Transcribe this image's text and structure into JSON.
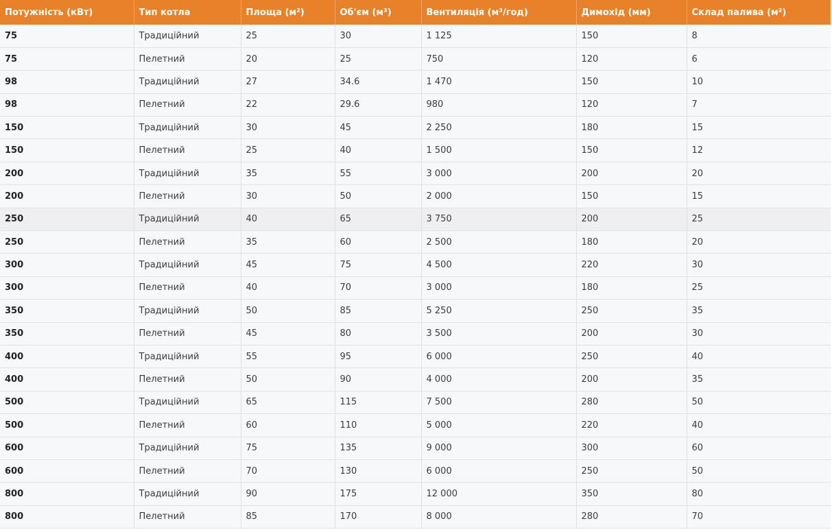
{
  "table": {
    "headers": [
      "Потужність (кВт)",
      "Тип котла",
      "Площа (м²)",
      "Об'єм (м³)",
      "Вентиляція (м³/год)",
      "Димохід (мм)",
      "Склад палива (м²)"
    ],
    "rows": [
      [
        "75",
        "Традиційний",
        "25",
        "30",
        "1 125",
        "150",
        "8"
      ],
      [
        "75",
        "Пелетний",
        "20",
        "25",
        "750",
        "120",
        "6"
      ],
      [
        "98",
        "Традиційний",
        "27",
        "34.6",
        "1 470",
        "150",
        "10"
      ],
      [
        "98",
        "Пелетний",
        "22",
        "29.6",
        "980",
        "120",
        "7"
      ],
      [
        "150",
        "Традиційний",
        "30",
        "45",
        "2 250",
        "180",
        "15"
      ],
      [
        "150",
        "Пелетний",
        "25",
        "40",
        "1 500",
        "150",
        "12"
      ],
      [
        "200",
        "Традиційний",
        "35",
        "55",
        "3 000",
        "200",
        "20"
      ],
      [
        "200",
        "Пелетний",
        "30",
        "50",
        "2 000",
        "150",
        "15"
      ],
      [
        "250",
        "Традиційний",
        "40",
        "65",
        "3 750",
        "200",
        "25"
      ],
      [
        "250",
        "Пелетний",
        "35",
        "60",
        "2 500",
        "180",
        "20"
      ],
      [
        "300",
        "Традиційний",
        "45",
        "75",
        "4 500",
        "220",
        "30"
      ],
      [
        "300",
        "Пелетний",
        "40",
        "70",
        "3 000",
        "180",
        "25"
      ],
      [
        "350",
        "Традиційний",
        "50",
        "85",
        "5 250",
        "250",
        "35"
      ],
      [
        "350",
        "Пелетний",
        "45",
        "80",
        "3 500",
        "200",
        "30"
      ],
      [
        "400",
        "Традиційний",
        "55",
        "95",
        "6 000",
        "250",
        "40"
      ],
      [
        "400",
        "Пелетний",
        "50",
        "90",
        "4 000",
        "200",
        "35"
      ],
      [
        "500",
        "Традиційний",
        "65",
        "115",
        "7 500",
        "280",
        "50"
      ],
      [
        "500",
        "Пелетний",
        "60",
        "110",
        "5 000",
        "220",
        "40"
      ],
      [
        "600",
        "Традиційний",
        "75",
        "135",
        "9 000",
        "300",
        "60"
      ],
      [
        "600",
        "Пелетний",
        "70",
        "130",
        "6 000",
        "250",
        "50"
      ],
      [
        "800",
        "Традиційний",
        "90",
        "175",
        "12 000",
        "350",
        "80"
      ],
      [
        "800",
        "Пелетний",
        "85",
        "170",
        "8 000",
        "280",
        "70"
      ]
    ]
  },
  "colors": {
    "header_bg": "#e8822a",
    "header_text": "#ffffff",
    "row_bg": "#f7f8fa",
    "hover_row_bg": "#efeff1"
  }
}
